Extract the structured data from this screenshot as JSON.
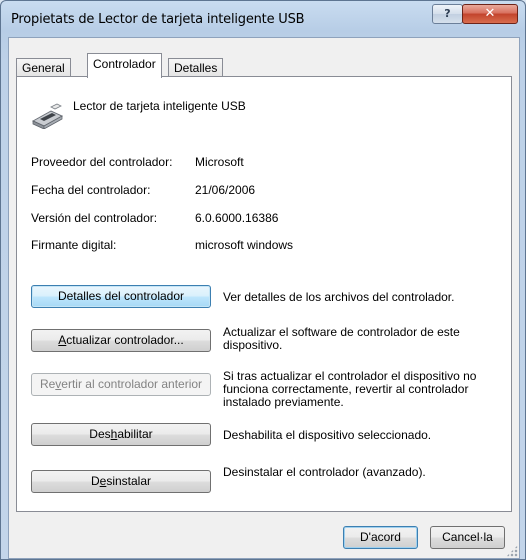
{
  "window": {
    "title": "Propietats de Lector de tarjeta inteligente USB",
    "help_glyph": "?",
    "close_glyph": "✕"
  },
  "tabs": [
    {
      "label": "General",
      "active": false
    },
    {
      "label": "Controlador",
      "active": true
    },
    {
      "label": "Detalles",
      "active": false
    }
  ],
  "device": {
    "icon": "smart-card-reader-icon",
    "name": "Lector de tarjeta inteligente USB"
  },
  "info": [
    {
      "label": "Proveedor del controlador:",
      "value": "Microsoft"
    },
    {
      "label": "Fecha del controlador:",
      "value": "21/06/2006"
    },
    {
      "label": "Versión del controlador:",
      "value": "6.0.6000.16386"
    },
    {
      "label": "Firmante digital:",
      "value": "microsoft windows"
    }
  ],
  "actions": {
    "details": {
      "label_before": "Detalles del controlador",
      "label_key": "",
      "label_after": "",
      "desc": "Ver detalles de los archivos del controlador."
    },
    "update": {
      "label_before": "",
      "label_key": "A",
      "label_after": "ctualizar controlador...",
      "desc": "Actualizar el software de controlador de este dispositivo."
    },
    "rollback": {
      "label_before": "Re",
      "label_key": "v",
      "label_after": "ertir al controlador anterior",
      "desc": "Si tras actualizar el controlador el dispositivo no funciona correctamente, revertir al controlador instalado previamente."
    },
    "disable": {
      "label_before": "Des",
      "label_key": "h",
      "label_after": "abilitar",
      "desc": "Deshabilita el dispositivo seleccionado."
    },
    "uninstall": {
      "label_before": "D",
      "label_key": "e",
      "label_after": "sinstalar",
      "desc": "Desinstalar el controlador (avanzado)."
    }
  },
  "footer": {
    "ok_label": "D'acord",
    "cancel_label": "Cancel·la"
  }
}
